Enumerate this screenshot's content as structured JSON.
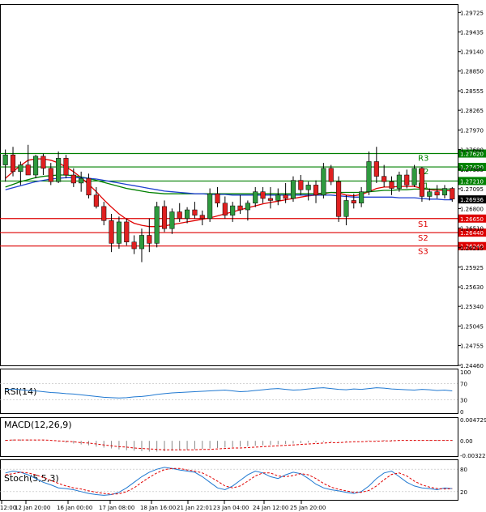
{
  "chart_data": [
    {
      "type": "candlestick",
      "price_axis_ticks": [
        "1.29725",
        "1.29435",
        "1.29140",
        "1.28850",
        "1.28555",
        "1.28265",
        "1.27970",
        "1.27680",
        "1.27385",
        "1.27095",
        "1.26800",
        "1.26510",
        "1.26215",
        "1.25925",
        "1.25630",
        "1.25340",
        "1.25045",
        "1.24755",
        "1.24460"
      ],
      "ylim": [
        1.2446,
        1.2985
      ],
      "current_price": "1.26936",
      "time_labels": [
        "12:00",
        "12 Jan 20:00",
        "16 Jan 00:00",
        "17 Jan 08:00",
        "18 Jan 16:00",
        "21 Jan 22:01",
        "23 Jan 04:00",
        "24 Jan 12:00",
        "25 Jan 20:00"
      ],
      "levels": [
        {
          "label": "R3",
          "value": "1.27620",
          "color": "#008000"
        },
        {
          "label": "R2",
          "value": "1.27420",
          "color": "#008000"
        },
        {
          "label": "R1",
          "value": "1.27210",
          "color": "#008000"
        },
        {
          "label": "S1",
          "value": "1.26650",
          "color": "#dd0000"
        },
        {
          "label": "S2",
          "value": "1.26440",
          "color": "#dd0000"
        },
        {
          "label": "S3",
          "value": "1.26240",
          "color": "#dd0000"
        }
      ],
      "candles": [
        [
          1.2745,
          1.2768,
          1.272,
          1.276
        ],
        [
          1.276,
          1.2772,
          1.2728,
          1.2735
        ],
        [
          1.2735,
          1.275,
          1.2715,
          1.2745
        ],
        [
          1.2745,
          1.2775,
          1.273,
          1.273
        ],
        [
          1.273,
          1.276,
          1.2725,
          1.2758
        ],
        [
          1.2758,
          1.2762,
          1.273,
          1.274
        ],
        [
          1.274,
          1.2748,
          1.2715,
          1.272
        ],
        [
          1.272,
          1.2765,
          1.2718,
          1.2755
        ],
        [
          1.2755,
          1.276,
          1.2725,
          1.273
        ],
        [
          1.273,
          1.274,
          1.2712,
          1.2718
        ],
        [
          1.2718,
          1.2735,
          1.2705,
          1.2725
        ],
        [
          1.2725,
          1.2732,
          1.2695,
          1.27
        ],
        [
          1.27,
          1.2712,
          1.268,
          1.2683
        ],
        [
          1.2683,
          1.269,
          1.2655,
          1.2662
        ],
        [
          1.2662,
          1.2672,
          1.2615,
          1.2628
        ],
        [
          1.2628,
          1.2668,
          1.262,
          1.266
        ],
        [
          1.266,
          1.2665,
          1.2625,
          1.263
        ],
        [
          1.263,
          1.264,
          1.2612,
          1.262
        ],
        [
          1.262,
          1.265,
          1.26,
          1.264
        ],
        [
          1.264,
          1.2665,
          1.2615,
          1.2628
        ],
        [
          1.2628,
          1.269,
          1.2622,
          1.2683
        ],
        [
          1.2683,
          1.2692,
          1.2645,
          1.265
        ],
        [
          1.265,
          1.268,
          1.2642,
          1.2675
        ],
        [
          1.2675,
          1.2688,
          1.266,
          1.2665
        ],
        [
          1.2665,
          1.2682,
          1.2658,
          1.2678
        ],
        [
          1.2678,
          1.269,
          1.2665,
          1.267
        ],
        [
          1.267,
          1.2677,
          1.2655,
          1.2665
        ],
        [
          1.2665,
          1.271,
          1.266,
          1.2702
        ],
        [
          1.2702,
          1.2712,
          1.2682,
          1.2688
        ],
        [
          1.2688,
          1.2698,
          1.2665,
          1.267
        ],
        [
          1.267,
          1.269,
          1.266,
          1.2684
        ],
        [
          1.2684,
          1.27,
          1.2672,
          1.2678
        ],
        [
          1.2678,
          1.2692,
          1.2662,
          1.2688
        ],
        [
          1.2688,
          1.2712,
          1.2682,
          1.2705
        ],
        [
          1.2705,
          1.2712,
          1.2688,
          1.2695
        ],
        [
          1.2695,
          1.2712,
          1.268,
          1.2692
        ],
        [
          1.2692,
          1.271,
          1.2685,
          1.27
        ],
        [
          1.27,
          1.2718,
          1.2688,
          1.2695
        ],
        [
          1.2695,
          1.2728,
          1.269,
          1.2722
        ],
        [
          1.2722,
          1.273,
          1.27,
          1.2708
        ],
        [
          1.2708,
          1.272,
          1.2692,
          1.2715
        ],
        [
          1.2715,
          1.2722,
          1.2688,
          1.27
        ],
        [
          1.27,
          1.2748,
          1.2695,
          1.274
        ],
        [
          1.274,
          1.2745,
          1.2715,
          1.272
        ],
        [
          1.272,
          1.2728,
          1.266,
          1.2668
        ],
        [
          1.2668,
          1.27,
          1.2655,
          1.2692
        ],
        [
          1.2692,
          1.2702,
          1.268,
          1.2688
        ],
        [
          1.2688,
          1.2712,
          1.2682,
          1.2705
        ],
        [
          1.2705,
          1.2765,
          1.27,
          1.275
        ],
        [
          1.275,
          1.2772,
          1.2718,
          1.2728
        ],
        [
          1.2728,
          1.2745,
          1.2712,
          1.272
        ],
        [
          1.272,
          1.2728,
          1.27,
          1.271
        ],
        [
          1.271,
          1.2735,
          1.2705,
          1.273
        ],
        [
          1.273,
          1.2738,
          1.271,
          1.2715
        ],
        [
          1.2715,
          1.2745,
          1.2712,
          1.274
        ],
        [
          1.274,
          1.2742,
          1.269,
          1.2698
        ],
        [
          1.2698,
          1.271,
          1.2692,
          1.2705
        ],
        [
          1.2705,
          1.2715,
          1.2695,
          1.27
        ],
        [
          1.27,
          1.2715,
          1.2695,
          1.271
        ],
        [
          1.271,
          1.2712,
          1.269,
          1.2694
        ]
      ],
      "moving_averages": [
        {
          "color": "#e00000",
          "values": [
            1.2725,
            1.2735,
            1.2744,
            1.2752,
            1.2754,
            1.2754,
            1.2752,
            1.2748,
            1.2742,
            1.2735,
            1.2726,
            1.2716,
            1.2705,
            1.2693,
            1.2682,
            1.2672,
            1.2664,
            1.2658,
            1.2655,
            1.2653,
            1.2653,
            1.2654,
            1.2656,
            1.2658,
            1.266,
            1.2662,
            1.2664,
            1.2666,
            1.2669,
            1.2672,
            1.2675,
            1.2678,
            1.2681,
            1.2684,
            1.2687,
            1.2689,
            1.2691,
            1.2693,
            1.2695,
            1.2697,
            1.2699,
            1.27,
            1.2702,
            1.2704,
            1.2703,
            1.27,
            1.2699,
            1.2701,
            1.2705,
            1.271,
            1.2712,
            1.2712,
            1.2713,
            1.2713,
            1.2713,
            1.271,
            1.2708,
            1.2707,
            1.2707,
            1.2706
          ]
        },
        {
          "color": "#008000",
          "values": [
            1.2712,
            1.2716,
            1.272,
            1.2723,
            1.2726,
            1.2728,
            1.2729,
            1.273,
            1.273,
            1.2729,
            1.2727,
            1.2725,
            1.2722,
            1.2719,
            1.2716,
            1.2713,
            1.271,
            1.2708,
            1.2706,
            1.2704,
            1.2703,
            1.2702,
            1.2702,
            1.2702,
            1.2702,
            1.2702,
            1.2702,
            1.2702,
            1.2702,
            1.2702,
            1.2702,
            1.2702,
            1.2702,
            1.2702,
            1.2702,
            1.2702,
            1.2702,
            1.2702,
            1.2702,
            1.2702,
            1.2702,
            1.2702,
            1.2703,
            1.2704,
            1.2704,
            1.2704,
            1.2704,
            1.2704,
            1.2705,
            1.2706,
            1.2707,
            1.2707,
            1.2708,
            1.2708,
            1.2709,
            1.2709,
            1.2709,
            1.2709,
            1.2709,
            1.2709
          ]
        },
        {
          "color": "#2040d0",
          "values": [
            1.2708,
            1.2711,
            1.2714,
            1.2717,
            1.272,
            1.2722,
            1.2724,
            1.2725,
            1.2726,
            1.2726,
            1.2726,
            1.2725,
            1.2724,
            1.2722,
            1.272,
            1.2718,
            1.2716,
            1.2714,
            1.2712,
            1.271,
            1.2708,
            1.2706,
            1.2705,
            1.2704,
            1.2703,
            1.2702,
            1.2702,
            1.2701,
            1.2701,
            1.2701,
            1.27,
            1.27,
            1.27,
            1.27,
            1.27,
            1.27,
            1.27,
            1.27,
            1.27,
            1.27,
            1.27,
            1.27,
            1.27,
            1.27,
            1.2699,
            1.2698,
            1.2697,
            1.2697,
            1.2697,
            1.2697,
            1.2697,
            1.2697,
            1.2696,
            1.2696,
            1.2696,
            1.2695,
            1.2694,
            1.2694,
            1.2693,
            1.2693
          ]
        }
      ]
    },
    {
      "type": "line",
      "name": "RSI(14)",
      "ticks": [
        "100",
        "70",
        "30",
        "0"
      ],
      "ylim": [
        0,
        100
      ],
      "values": [
        55,
        57,
        55,
        53,
        52,
        50,
        48,
        47,
        45,
        44,
        42,
        40,
        38,
        36,
        35,
        34,
        35,
        37,
        38,
        40,
        43,
        45,
        47,
        48,
        49,
        50,
        51,
        52,
        53,
        54,
        52,
        50,
        51,
        53,
        55,
        57,
        58,
        56,
        54,
        55,
        57,
        59,
        60,
        58,
        56,
        55,
        57,
        56,
        58,
        60,
        59,
        57,
        56,
        55,
        54,
        56,
        55,
        53,
        54,
        52
      ]
    },
    {
      "type": "bar",
      "name": "MACD(12,26,9)",
      "ticks": [
        "0.004729",
        "0.00",
        "-0.003222"
      ],
      "ylim": [
        -0.003222,
        0.004729
      ],
      "values": [
        0.0002,
        0.0003,
        0.0003,
        0.0003,
        0.0002,
        0.0001,
        0.0,
        -0.0002,
        -0.0004,
        -0.0006,
        -0.0008,
        -0.001,
        -0.0013,
        -0.0015,
        -0.0017,
        -0.0019,
        -0.0021,
        -0.0022,
        -0.0023,
        -0.0024,
        -0.0024,
        -0.0023,
        -0.0022,
        -0.0021,
        -0.002,
        -0.0019,
        -0.0018,
        -0.0017,
        -0.0016,
        -0.0015,
        -0.0014,
        -0.0013,
        -0.0012,
        -0.0011,
        -0.001,
        -0.0009,
        -0.0008,
        -0.0007,
        -0.0006,
        -0.0005,
        -0.0004,
        -0.0003,
        -0.0002,
        -0.0002,
        -0.0001,
        -0.0001,
        0.0,
        0.0,
        0.0001,
        0.0001,
        0.0002,
        0.0002,
        0.0002,
        0.0002,
        0.0002,
        0.0002,
        0.0002,
        0.0002,
        0.0002,
        0.0002
      ],
      "signal": [
        0.0001,
        0.0002,
        0.0002,
        0.0002,
        0.0002,
        0.0002,
        0.0001,
        0.0,
        -0.0001,
        -0.0002,
        -0.0004,
        -0.0005,
        -0.0007,
        -0.0009,
        -0.0011,
        -0.0013,
        -0.0014,
        -0.0016,
        -0.0017,
        -0.0018,
        -0.0019,
        -0.002,
        -0.002,
        -0.002,
        -0.002,
        -0.002,
        -0.0019,
        -0.0019,
        -0.0018,
        -0.0017,
        -0.0016,
        -0.0016,
        -0.0015,
        -0.0014,
        -0.0013,
        -0.0012,
        -0.0011,
        -0.001,
        -0.0009,
        -0.0008,
        -0.0007,
        -0.0006,
        -0.0005,
        -0.0004,
        -0.0004,
        -0.0003,
        -0.0002,
        -0.0002,
        -0.0001,
        -0.0001,
        0.0,
        0.0,
        0.0001,
        0.0001,
        0.0001,
        0.0001,
        0.0001,
        0.0001,
        0.0001,
        0.0001
      ]
    },
    {
      "type": "line",
      "name": "Stoch(5,5,3)",
      "ticks": [
        "80",
        "20"
      ],
      "ylim": [
        0,
        100
      ],
      "main": [
        70,
        75,
        72,
        65,
        55,
        45,
        38,
        30,
        28,
        25,
        20,
        15,
        12,
        10,
        12,
        18,
        30,
        45,
        60,
        72,
        80,
        85,
        82,
        78,
        75,
        72,
        60,
        45,
        30,
        25,
        35,
        50,
        65,
        75,
        70,
        60,
        55,
        65,
        72,
        68,
        55,
        40,
        30,
        25,
        22,
        18,
        15,
        20,
        35,
        55,
        70,
        75,
        60,
        45,
        35,
        30,
        28,
        25,
        30,
        28
      ],
      "signal": [
        65,
        68,
        72,
        70,
        65,
        58,
        50,
        42,
        35,
        30,
        27,
        22,
        18,
        15,
        13,
        14,
        20,
        30,
        45,
        58,
        70,
        79,
        82,
        82,
        78,
        75,
        70,
        60,
        48,
        35,
        30,
        35,
        48,
        62,
        70,
        70,
        62,
        60,
        63,
        68,
        65,
        55,
        42,
        32,
        26,
        22,
        18,
        18,
        23,
        35,
        52,
        66,
        70,
        62,
        48,
        38,
        32,
        28,
        27,
        28
      ]
    }
  ]
}
